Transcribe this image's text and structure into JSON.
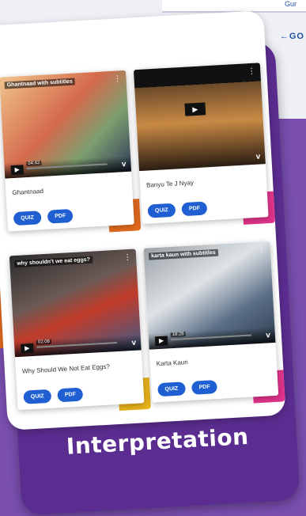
{
  "background": {
    "back_link": "←GO",
    "top_bar_text": "Gur"
  },
  "tiles": [
    {
      "title": "Ghantnaad",
      "overlay_label": "Ghantnaad with subtitles",
      "time": "04:42",
      "buttons": [
        "QUIZ",
        "PDF"
      ],
      "accent_color": "#e36a1e"
    },
    {
      "title": "Banyu Te J Nyay",
      "overlay_label": "",
      "time": "",
      "buttons": [
        "QUIZ",
        "PDF"
      ],
      "accent_color": "#e0338a"
    },
    {
      "title": "Why Should We Not Eat Eggs?",
      "overlay_label": "why shouldn't we eat eggs?",
      "time": "02:08",
      "buttons": [
        "QUIZ",
        "PDF"
      ],
      "accent_color": "#e8b21c"
    },
    {
      "title": "Karta Kaun",
      "overlay_label": "karta kaun with subtitles",
      "time": "18:28",
      "buttons": [
        "QUIZ",
        "PDF"
      ],
      "accent_color": "#e0338a"
    }
  ],
  "footer": {
    "title": "Interpretation"
  }
}
